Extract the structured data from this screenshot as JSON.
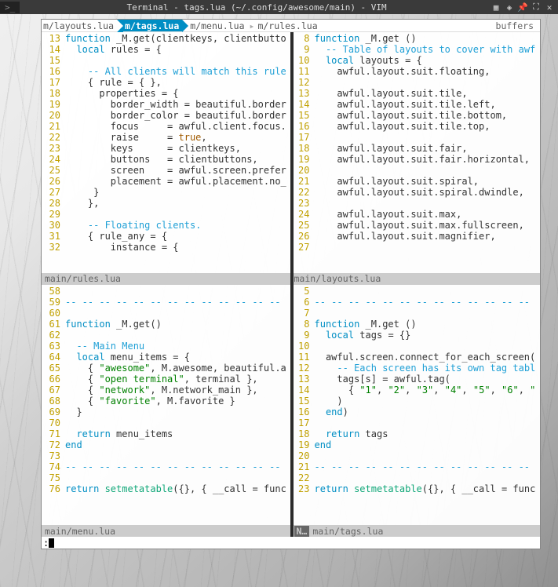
{
  "titlebar": {
    "arrow": ">_",
    "title": "Terminal - tags.lua (~/.config/awesome/main) - VIM"
  },
  "bufferline": {
    "tabs": [
      {
        "label": "m/layouts.lua",
        "active": false
      },
      {
        "label": "m/tags.lua",
        "active": true
      },
      {
        "label": "m/menu.lua",
        "active": false
      },
      {
        "label": "m/rules.lua",
        "active": false
      }
    ],
    "right": "buffers"
  },
  "panes": {
    "tl": {
      "status": "main/rules.lua",
      "lines": [
        {
          "n": "13",
          "t": [
            [
              "kw",
              "function"
            ],
            [
              "ident",
              " _M.get(clientkeys, clientbutto"
            ]
          ]
        },
        {
          "n": "14",
          "t": [
            [
              "ident",
              "  "
            ],
            [
              "kw",
              "local"
            ],
            [
              "ident",
              " rules "
            ],
            [
              "punct",
              "= {"
            ]
          ]
        },
        {
          "n": "15",
          "t": []
        },
        {
          "n": "16",
          "t": [
            [
              "ident",
              "    "
            ],
            [
              "cmt",
              "-- All clients will match this rule"
            ]
          ]
        },
        {
          "n": "17",
          "t": [
            [
              "ident",
              "    "
            ],
            [
              "punct",
              "{"
            ],
            [
              "ident",
              " rule "
            ],
            [
              "punct",
              "= { },"
            ]
          ]
        },
        {
          "n": "18",
          "t": [
            [
              "ident",
              "      properties "
            ],
            [
              "punct",
              "= {"
            ]
          ]
        },
        {
          "n": "19",
          "t": [
            [
              "ident",
              "        border_width "
            ],
            [
              "punct",
              "="
            ],
            [
              "ident",
              " beautiful.border"
            ]
          ]
        },
        {
          "n": "20",
          "t": [
            [
              "ident",
              "        border_color "
            ],
            [
              "punct",
              "="
            ],
            [
              "ident",
              " beautiful.border"
            ]
          ]
        },
        {
          "n": "21",
          "t": [
            [
              "ident",
              "        focus     "
            ],
            [
              "punct",
              "="
            ],
            [
              "ident",
              " awful.client.focus."
            ]
          ]
        },
        {
          "n": "22",
          "t": [
            [
              "ident",
              "        raise     "
            ],
            [
              "punct",
              "= "
            ],
            [
              "bool",
              "true"
            ],
            [
              "punct",
              ","
            ]
          ]
        },
        {
          "n": "23",
          "t": [
            [
              "ident",
              "        keys      "
            ],
            [
              "punct",
              "="
            ],
            [
              "ident",
              " clientkeys,"
            ]
          ]
        },
        {
          "n": "24",
          "t": [
            [
              "ident",
              "        buttons   "
            ],
            [
              "punct",
              "="
            ],
            [
              "ident",
              " clientbuttons,"
            ]
          ]
        },
        {
          "n": "25",
          "t": [
            [
              "ident",
              "        screen    "
            ],
            [
              "punct",
              "="
            ],
            [
              "ident",
              " awful.screen.prefer"
            ]
          ]
        },
        {
          "n": "26",
          "t": [
            [
              "ident",
              "        placement "
            ],
            [
              "punct",
              "="
            ],
            [
              "ident",
              " awful.placement.no_"
            ]
          ]
        },
        {
          "n": "27",
          "t": [
            [
              "ident",
              "     "
            ],
            [
              "punct",
              "}"
            ]
          ]
        },
        {
          "n": "28",
          "t": [
            [
              "ident",
              "    "
            ],
            [
              "punct",
              "},"
            ]
          ]
        },
        {
          "n": "29",
          "t": []
        },
        {
          "n": "30",
          "t": [
            [
              "ident",
              "    "
            ],
            [
              "cmt",
              "-- Floating clients."
            ]
          ]
        },
        {
          "n": "31",
          "t": [
            [
              "ident",
              "    "
            ],
            [
              "punct",
              "{"
            ],
            [
              "ident",
              " rule_any "
            ],
            [
              "punct",
              "= {"
            ]
          ]
        },
        {
          "n": "32",
          "t": [
            [
              "ident",
              "        instance "
            ],
            [
              "punct",
              "= {"
            ]
          ]
        }
      ]
    },
    "tr": {
      "status": "main/layouts.lua",
      "lines": [
        {
          "n": "8",
          "t": [
            [
              "kw",
              "function"
            ],
            [
              "ident",
              " _M.get "
            ],
            [
              "punct",
              "()"
            ]
          ]
        },
        {
          "n": "9",
          "t": [
            [
              "ident",
              "  "
            ],
            [
              "cmt",
              "-- Table of layouts to cover with awf"
            ]
          ]
        },
        {
          "n": "10",
          "t": [
            [
              "ident",
              "  "
            ],
            [
              "kw",
              "local"
            ],
            [
              "ident",
              " layouts "
            ],
            [
              "punct",
              "= {"
            ]
          ]
        },
        {
          "n": "11",
          "t": [
            [
              "ident",
              "    awful.layout.suit.floating,"
            ]
          ]
        },
        {
          "n": "12",
          "t": []
        },
        {
          "n": "13",
          "t": [
            [
              "ident",
              "    awful.layout.suit.tile,"
            ]
          ]
        },
        {
          "n": "14",
          "t": [
            [
              "ident",
              "    awful.layout.suit.tile.left,"
            ]
          ]
        },
        {
          "n": "15",
          "t": [
            [
              "ident",
              "    awful.layout.suit.tile.bottom,"
            ]
          ]
        },
        {
          "n": "16",
          "t": [
            [
              "ident",
              "    awful.layout.suit.tile.top,"
            ]
          ]
        },
        {
          "n": "17",
          "t": []
        },
        {
          "n": "18",
          "t": [
            [
              "ident",
              "    awful.layout.suit.fair,"
            ]
          ]
        },
        {
          "n": "19",
          "t": [
            [
              "ident",
              "    awful.layout.suit.fair.horizontal,"
            ]
          ]
        },
        {
          "n": "20",
          "t": []
        },
        {
          "n": "21",
          "t": [
            [
              "ident",
              "    awful.layout.suit.spiral,"
            ]
          ]
        },
        {
          "n": "22",
          "t": [
            [
              "ident",
              "    awful.layout.suit.spiral.dwindle,"
            ]
          ]
        },
        {
          "n": "23",
          "t": []
        },
        {
          "n": "24",
          "t": [
            [
              "ident",
              "    awful.layout.suit.max,"
            ]
          ]
        },
        {
          "n": "25",
          "t": [
            [
              "ident",
              "    awful.layout.suit.max.fullscreen,"
            ]
          ]
        },
        {
          "n": "26",
          "t": [
            [
              "ident",
              "    awful.layout.suit.magnifier,"
            ]
          ]
        },
        {
          "n": "27",
          "t": []
        }
      ]
    },
    "bl": {
      "status": "main/menu.lua",
      "lines": [
        {
          "n": "58",
          "t": []
        },
        {
          "n": "59",
          "t": [
            [
              "foldline",
              "-- -- -- -- -- -- -- -- -- -- -- -- --"
            ]
          ]
        },
        {
          "n": "60",
          "t": []
        },
        {
          "n": "61",
          "t": [
            [
              "kw",
              "function"
            ],
            [
              "ident",
              " _M.get()"
            ]
          ]
        },
        {
          "n": "62",
          "t": []
        },
        {
          "n": "63",
          "t": [
            [
              "ident",
              "  "
            ],
            [
              "cmt",
              "-- Main Menu"
            ]
          ]
        },
        {
          "n": "64",
          "t": [
            [
              "ident",
              "  "
            ],
            [
              "kw",
              "local"
            ],
            [
              "ident",
              " menu_items "
            ],
            [
              "punct",
              "= {"
            ]
          ]
        },
        {
          "n": "65",
          "t": [
            [
              "ident",
              "    "
            ],
            [
              "punct",
              "{ "
            ],
            [
              "str",
              "\"awesome\""
            ],
            [
              "punct",
              ", M.awesome, beautiful.a"
            ]
          ]
        },
        {
          "n": "66",
          "t": [
            [
              "ident",
              "    "
            ],
            [
              "punct",
              "{ "
            ],
            [
              "str",
              "\"open terminal\""
            ],
            [
              "punct",
              ", terminal },"
            ]
          ]
        },
        {
          "n": "67",
          "t": [
            [
              "ident",
              "    "
            ],
            [
              "punct",
              "{ "
            ],
            [
              "str",
              "\"network\""
            ],
            [
              "punct",
              ", M.network_main },"
            ]
          ]
        },
        {
          "n": "68",
          "t": [
            [
              "ident",
              "    "
            ],
            [
              "punct",
              "{ "
            ],
            [
              "str",
              "\"favorite\""
            ],
            [
              "punct",
              ", M.favorite }"
            ]
          ]
        },
        {
          "n": "69",
          "t": [
            [
              "ident",
              "  "
            ],
            [
              "punct",
              "}"
            ]
          ]
        },
        {
          "n": "70",
          "t": []
        },
        {
          "n": "71",
          "t": [
            [
              "ident",
              "  "
            ],
            [
              "kw",
              "return"
            ],
            [
              "ident",
              " menu_items"
            ]
          ]
        },
        {
          "n": "72",
          "t": [
            [
              "kw",
              "end"
            ]
          ]
        },
        {
          "n": "73",
          "t": []
        },
        {
          "n": "74",
          "t": [
            [
              "foldline",
              "-- -- -- -- -- -- -- -- -- -- -- -- --"
            ]
          ]
        },
        {
          "n": "75",
          "t": []
        },
        {
          "n": "76",
          "t": [
            [
              "kw",
              "return "
            ],
            [
              "fn",
              "setmetatable"
            ],
            [
              "punct",
              "({}, { "
            ],
            [
              "ident",
              "__call"
            ],
            [
              "punct",
              " = func"
            ]
          ]
        }
      ]
    },
    "br": {
      "status": "main/tags.lua",
      "mod": "N…",
      "lines": [
        {
          "n": "5",
          "t": []
        },
        {
          "n": "6",
          "t": [
            [
              "foldline",
              "-- -- -- -- -- -- -- -- -- -- -- -- --"
            ]
          ]
        },
        {
          "n": "7",
          "t": []
        },
        {
          "n": "8",
          "t": [
            [
              "kw",
              "function"
            ],
            [
              "ident",
              " _M.get "
            ],
            [
              "punct",
              "()"
            ]
          ]
        },
        {
          "n": "9",
          "t": [
            [
              "ident",
              "  "
            ],
            [
              "kw",
              "local"
            ],
            [
              "ident",
              " tags "
            ],
            [
              "punct",
              "= {}"
            ]
          ]
        },
        {
          "n": "10",
          "t": []
        },
        {
          "n": "11",
          "t": [
            [
              "ident",
              "  awful.screen.connect_for_each_screen("
            ]
          ]
        },
        {
          "n": "12",
          "t": [
            [
              "ident",
              "    "
            ],
            [
              "cmt",
              "-- Each screen has its own tag tabl"
            ]
          ]
        },
        {
          "n": "13",
          "t": [
            [
              "ident",
              "    tags[s] "
            ],
            [
              "punct",
              "="
            ],
            [
              "ident",
              " awful.tag("
            ]
          ]
        },
        {
          "n": "14",
          "t": [
            [
              "ident",
              "      "
            ],
            [
              "punct",
              "{ "
            ],
            [
              "str",
              "\"1\""
            ],
            [
              "punct",
              ", "
            ],
            [
              "str",
              "\"2\""
            ],
            [
              "punct",
              ", "
            ],
            [
              "str",
              "\"3\""
            ],
            [
              "punct",
              ", "
            ],
            [
              "str",
              "\"4\""
            ],
            [
              "punct",
              ", "
            ],
            [
              "str",
              "\"5\""
            ],
            [
              "punct",
              ", "
            ],
            [
              "str",
              "\"6\""
            ],
            [
              "punct",
              ", "
            ],
            [
              "str",
              "\""
            ]
          ]
        },
        {
          "n": "15",
          "t": [
            [
              "ident",
              "    "
            ],
            [
              "punct",
              ")"
            ]
          ]
        },
        {
          "n": "16",
          "t": [
            [
              "ident",
              "  "
            ],
            [
              "kw",
              "end"
            ],
            [
              "punct",
              ")"
            ]
          ]
        },
        {
          "n": "17",
          "t": []
        },
        {
          "n": "18",
          "t": [
            [
              "ident",
              "  "
            ],
            [
              "kw",
              "return"
            ],
            [
              "ident",
              " tags"
            ]
          ]
        },
        {
          "n": "19",
          "t": [
            [
              "kw",
              "end"
            ]
          ]
        },
        {
          "n": "20",
          "t": []
        },
        {
          "n": "21",
          "t": [
            [
              "foldline",
              "-- -- -- -- -- -- -- -- -- -- -- -- --"
            ]
          ]
        },
        {
          "n": "22",
          "t": []
        },
        {
          "n": "23",
          "t": [
            [
              "kw",
              "return "
            ],
            [
              "fn",
              "setmetatable"
            ],
            [
              "punct",
              "({}, { "
            ],
            [
              "ident",
              "__call"
            ],
            [
              "punct",
              " = func"
            ]
          ]
        }
      ]
    }
  },
  "cmdline": ":"
}
